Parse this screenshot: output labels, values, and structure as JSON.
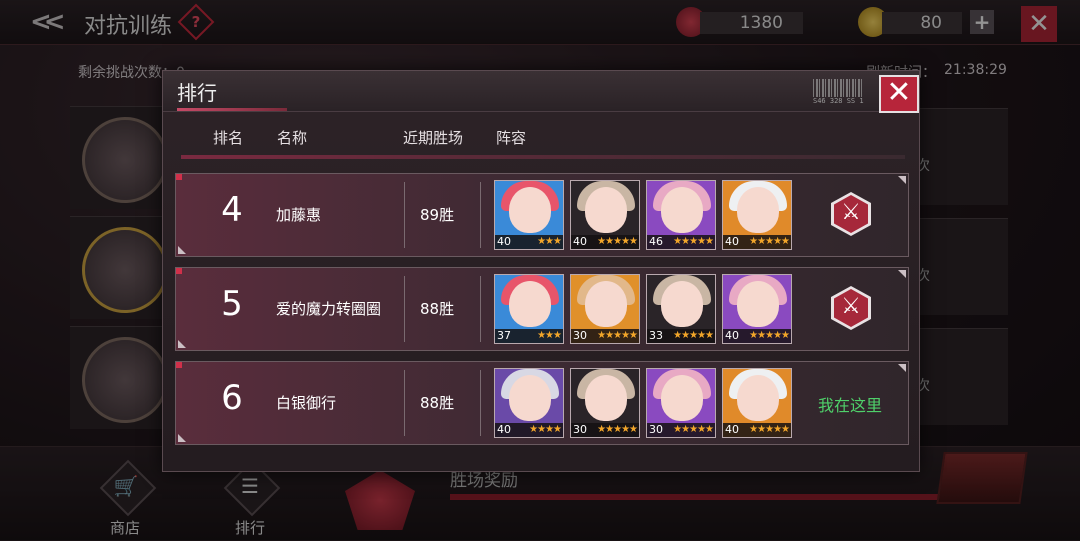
{
  "topbar": {
    "title": "对抗训练",
    "help": "?",
    "currency1_value": "1380",
    "currency2_value": "80",
    "plus": "+",
    "close": "✕"
  },
  "info": {
    "remaining_label": "剩余挑战次数：0",
    "refresh_label": "刷新时间：",
    "refresh_time": "21:38:29"
  },
  "side_ranks": [
    "次",
    "次",
    "次"
  ],
  "bottom": {
    "shop_label": "商店",
    "rank_label": "排行",
    "reward_label": "胜场奖励"
  },
  "modal": {
    "title": "排行",
    "barcode_text": "S46 328 SS 1",
    "close": "✕",
    "columns": {
      "rank": "排名",
      "name": "名称",
      "wins": "近期胜场",
      "team": "阵容"
    },
    "rows": [
      {
        "rank": "4",
        "name": "加藤惠",
        "wins": "89胜",
        "team": [
          {
            "level": "40",
            "stars": "★★★",
            "hair": "#e8556a",
            "bg": "#3a8ad8"
          },
          {
            "level": "40",
            "stars": "★★★★★",
            "hair": "#c9b6a4",
            "bg": "#2a2428"
          },
          {
            "level": "46",
            "stars": "★★★★★",
            "hair": "#e8a9c4",
            "bg": "#8a4ac0"
          },
          {
            "level": "40",
            "stars": "★★★★★",
            "hair": "#eef0f2",
            "bg": "#e08a2a"
          }
        ],
        "action": "challenge"
      },
      {
        "rank": "5",
        "name": "爱的魔力转圈圈",
        "wins": "88胜",
        "team": [
          {
            "level": "37",
            "stars": "★★★",
            "hair": "#e8556a",
            "bg": "#3a8ad8"
          },
          {
            "level": "30",
            "stars": "★★★★★",
            "hair": "#e2b88a",
            "bg": "#e0902a"
          },
          {
            "level": "33",
            "stars": "★★★★★",
            "hair": "#c9b6a4",
            "bg": "#2a2428"
          },
          {
            "level": "40",
            "stars": "★★★★★",
            "hair": "#e8a9c4",
            "bg": "#8a4ac0"
          }
        ],
        "action": "challenge"
      },
      {
        "rank": "6",
        "name": "白银御行",
        "wins": "88胜",
        "team": [
          {
            "level": "40",
            "stars": "★★★★",
            "hair": "#d8d8e4",
            "bg": "#6a4aa8"
          },
          {
            "level": "30",
            "stars": "★★★★★",
            "hair": "#c9b6a4",
            "bg": "#2a2428"
          },
          {
            "level": "30",
            "stars": "★★★★★",
            "hair": "#e8a9c4",
            "bg": "#8a4ac0"
          },
          {
            "level": "40",
            "stars": "★★★★★",
            "hair": "#eef0f2",
            "bg": "#e08a2a"
          }
        ],
        "action": "me",
        "me_label": "我在这里"
      }
    ]
  }
}
